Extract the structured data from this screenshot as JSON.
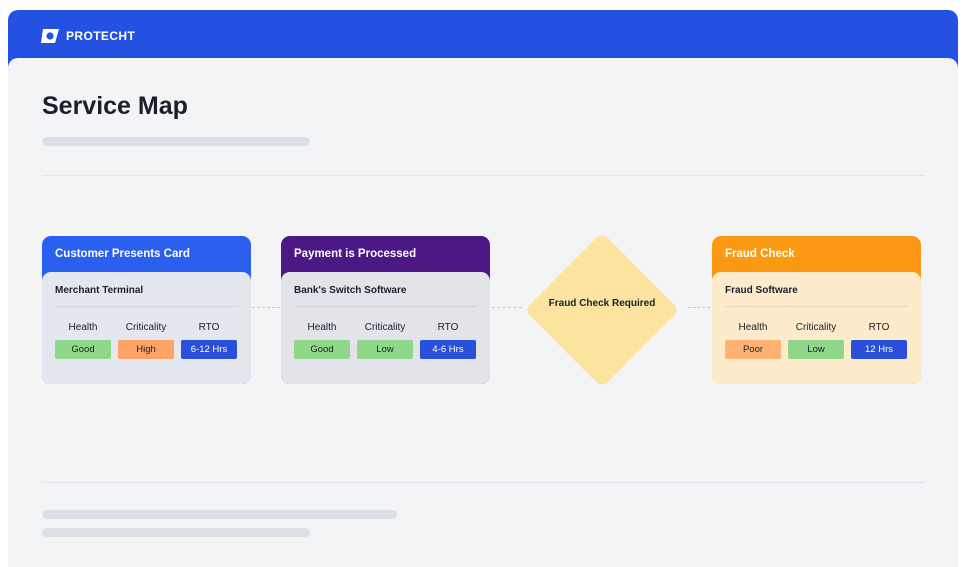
{
  "header": {
    "brand": "PROTECHT",
    "brand_color": "#2551e2"
  },
  "page": {
    "title": "Service Map"
  },
  "metric_labels": [
    "Health",
    "Criticality",
    "RTO"
  ],
  "diagram": {
    "steps": [
      {
        "title": "Customer Presents Card",
        "system": "Merchant Terminal",
        "health": "Good",
        "criticality": "High",
        "rto": "6-12 Hrs",
        "header_color": "#2b5ff0",
        "body_color": "#e5e7ef"
      },
      {
        "title": "Payment is Processed",
        "system": "Bank's Switch Software",
        "health": "Good",
        "criticality": "Low",
        "rto": "4-6 Hrs",
        "header_color": "#4b1886",
        "body_color": "#e3e4ea"
      },
      {
        "title": "Fraud Check",
        "system": "Fraud Software",
        "health": "Poor",
        "criticality": "Low",
        "rto": "12 Hrs",
        "header_color": "#fb9a12",
        "body_color": "#fdebcb"
      }
    ],
    "decision": {
      "label": "Fraud Check Required",
      "color": "#fde3a0"
    },
    "status_colors": {
      "good": "#8fd88a",
      "high": "#fca365",
      "poor": "#fcb371",
      "low": "#8fd88a",
      "rto": "#2a4fd8"
    }
  }
}
